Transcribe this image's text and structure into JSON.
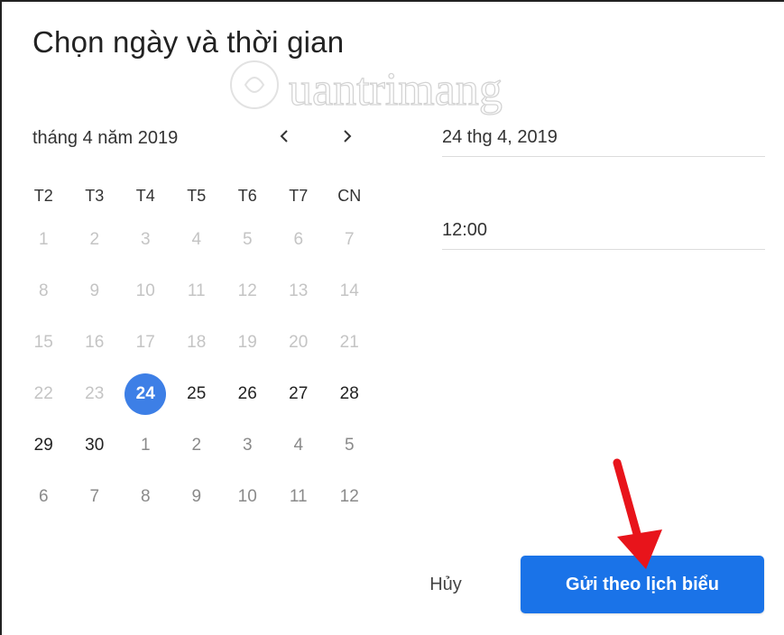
{
  "dialog": {
    "title": "Chọn ngày và thời gian"
  },
  "watermark": {
    "text": "Quantrimang"
  },
  "calendar": {
    "month_label": "tháng 4 năm 2019",
    "prev_icon": "chevron-left-icon",
    "next_icon": "chevron-right-icon",
    "weekdays": [
      "T2",
      "T3",
      "T4",
      "T5",
      "T6",
      "T7",
      "CN"
    ],
    "weeks": [
      [
        "1",
        "2",
        "3",
        "4",
        "5",
        "6",
        "7"
      ],
      [
        "8",
        "9",
        "10",
        "11",
        "12",
        "13",
        "14"
      ],
      [
        "15",
        "16",
        "17",
        "18",
        "19",
        "20",
        "21"
      ],
      [
        "22",
        "23",
        "24",
        "25",
        "26",
        "27",
        "28"
      ],
      [
        "29",
        "30",
        "1",
        "2",
        "3",
        "4",
        "5"
      ],
      [
        "6",
        "7",
        "8",
        "9",
        "10",
        "11",
        "12"
      ]
    ],
    "selected": "24"
  },
  "fields": {
    "date_value": "24 thg 4, 2019",
    "time_value": "12:00"
  },
  "actions": {
    "cancel_label": "Hủy",
    "schedule_label": "Gửi theo lịch biểu"
  },
  "colors": {
    "accent": "#1a73e8",
    "selected_day": "#3d7fe6",
    "annotation_arrow": "#e8141b"
  }
}
